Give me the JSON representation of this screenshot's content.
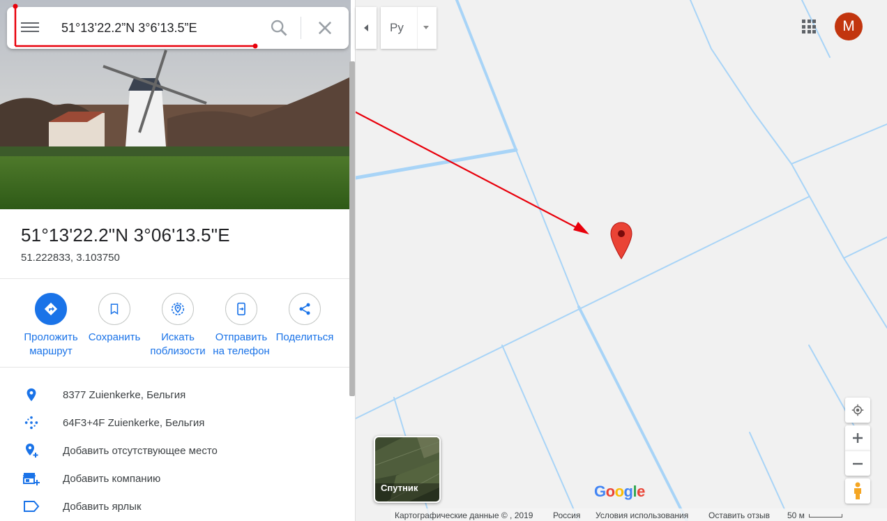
{
  "search": {
    "value": "51°13’22.2”N 3°6’13.5”E"
  },
  "place": {
    "title": "51°13'22.2\"N 3°06'13.5\"E",
    "subtitle": "51.222833, 3.103750"
  },
  "actions": [
    {
      "label": "Проложить\nмаршрут",
      "icon": "directions-icon"
    },
    {
      "label": "Сохранить",
      "icon": "bookmark-icon"
    },
    {
      "label": "Искать\nпоблизости",
      "icon": "nearby-icon"
    },
    {
      "label": "Отправить\nна телефон",
      "icon": "send-to-phone-icon"
    },
    {
      "label": "Поделиться",
      "icon": "share-icon"
    }
  ],
  "info": [
    {
      "text": "8377 Zuienkerke, Бельгия",
      "icon": "location-pin-icon"
    },
    {
      "text": "64F3+4F Zuienkerke, Бельгия",
      "icon": "plus-code-icon"
    },
    {
      "text": "Добавить отсутствующее место",
      "icon": "add-place-icon"
    },
    {
      "text": "Добавить компанию",
      "icon": "add-business-icon"
    },
    {
      "text": "Добавить ярлык",
      "icon": "label-icon"
    }
  ],
  "layers": {
    "label": "Ру"
  },
  "avatar": {
    "letter": "M",
    "color": "#c2350e"
  },
  "satellite": {
    "label": "Спутник"
  },
  "logo": {
    "text": "Google"
  },
  "footer": {
    "map_data": "Картографические данные © , 2019",
    "country": "Россия",
    "terms": "Условия использования",
    "feedback": "Оставить отзыв",
    "scale": "50 м"
  },
  "colors": {
    "accent": "#1a73e8",
    "pin": "#ea4335",
    "annotation": "#e8000b",
    "road": "#a8d4f7"
  }
}
